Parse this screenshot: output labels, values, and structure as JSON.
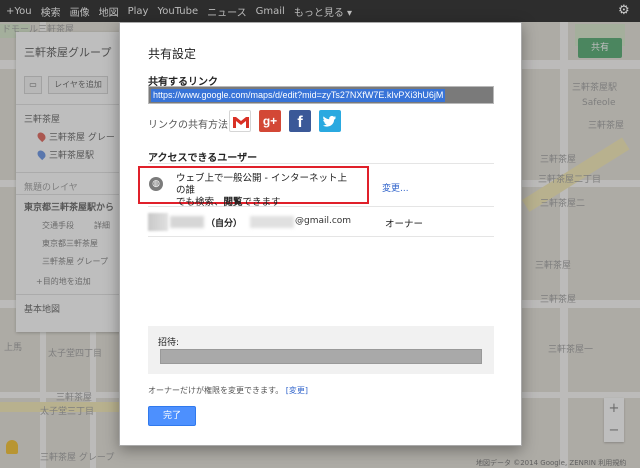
{
  "topbar": {
    "items": [
      "+You",
      "検索",
      "画像",
      "地図",
      "Play",
      "YouTube",
      "ニュース",
      "Gmail",
      "もっと見る ▾"
    ]
  },
  "left_panel": {
    "title": "三軒茶屋グループ",
    "add_layer": "レイヤを追加",
    "layer1_name": "三軒茶屋",
    "layer1_items": [
      "三軒茶屋 グレー",
      "三軒茶屋駅"
    ],
    "untitled_layer": "無題のレイヤ",
    "directions_title": "東京都三軒茶屋駅から",
    "directions_modes": [
      "交通手段",
      "詳細"
    ],
    "directions_points": [
      "東京都三軒茶屋",
      "三軒茶屋 グレープ"
    ],
    "add_destination": "+目的地を追加",
    "base_map": "基本地図"
  },
  "map": {
    "share_button": "共有",
    "footer": "地図データ ©2014 Google, ZENRIN  利用規約",
    "labels": [
      "ドモール三軒茶屋",
      "三軒茶屋",
      "三軒茶屋",
      "三軒茶屋二",
      "三軒茶屋",
      "三軒茶屋一",
      "太子堂三丁目",
      "三軒茶屋 グレープ",
      "上馬",
      "三軒茶屋",
      "太子堂四丁目",
      "三軒茶屋駅",
      "三軒茶屋",
      "Safeole",
      "三軒茶屋二丁目"
    ]
  },
  "dialog": {
    "title": "共有設定",
    "share_link_label": "共有するリンク",
    "share_link_url": "https://www.google.com/maps/d/edit?mid=zyTs27NXfW7E.kIvPXi3hU6jM",
    "share_method_label": "リンクの共有方法:",
    "share_icons": [
      "gmail-icon",
      "google-plus-icon",
      "facebook-icon",
      "twitter-icon"
    ],
    "gplus_text": "g+",
    "facebook_text": "f",
    "access_label": "アクセスできるユーザー",
    "access_line1": "ウェブ上で一般公開 - インターネット上の誰",
    "access_line2_a": "でも検索、",
    "access_line2_b": "閲覧",
    "access_line2_c": "できます",
    "change_link": "変更...",
    "owner_self": "（自分）",
    "owner_email_suffix": "@gmail.com",
    "owner_role": "オーナー",
    "invite_label": "招待:",
    "owner_note": "オーナーだけが権限を変更できます。",
    "owner_note_link": "[変更]",
    "done_button": "完了"
  },
  "colors": {
    "accent_blue": "#4d90fe",
    "link_blue": "#3366cc",
    "highlight_red": "#e0202a",
    "share_green": "#2f9a52"
  }
}
